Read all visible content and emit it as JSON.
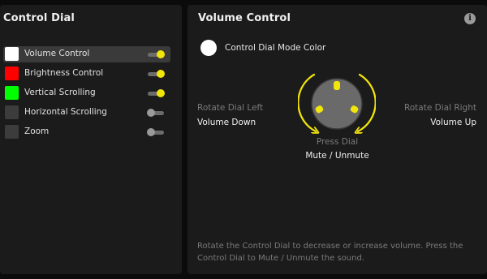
{
  "left_panel": {
    "title": "Control Dial",
    "modes": [
      {
        "label": "Volume Control",
        "color": "#ffffff",
        "enabled": true,
        "selected": true
      },
      {
        "label": "Brightness Control",
        "color": "#ff0000",
        "enabled": true,
        "selected": false
      },
      {
        "label": "Vertical Scrolling",
        "color": "#00ff00",
        "enabled": true,
        "selected": false
      },
      {
        "label": "Horizontal Scrolling",
        "color": "#3c3c3c",
        "enabled": false,
        "selected": false
      },
      {
        "label": "Zoom",
        "color": "#3c3c3c",
        "enabled": false,
        "selected": false
      }
    ]
  },
  "right_panel": {
    "title": "Volume Control",
    "info_icon": "info-icon",
    "mode_color_label": "Control Dial Mode Color",
    "mode_color": "#ffffff",
    "rotate_left_caption": "Rotate Dial Left",
    "rotate_left_action": "Volume Down",
    "rotate_right_caption": "Rotate Dial Right",
    "rotate_right_action": "Volume Up",
    "press_caption": "Press Dial",
    "press_action": "Mute / Unmute",
    "description": "Rotate the Control Dial to decrease or increase volume. Press the Control Dial to Mute / Unmute the sound."
  },
  "colors": {
    "accent": "#f2e50c",
    "panel_bg": "#1b1b1b",
    "selected_bg": "#3a3a3a",
    "dial": "#6a6a6a"
  }
}
